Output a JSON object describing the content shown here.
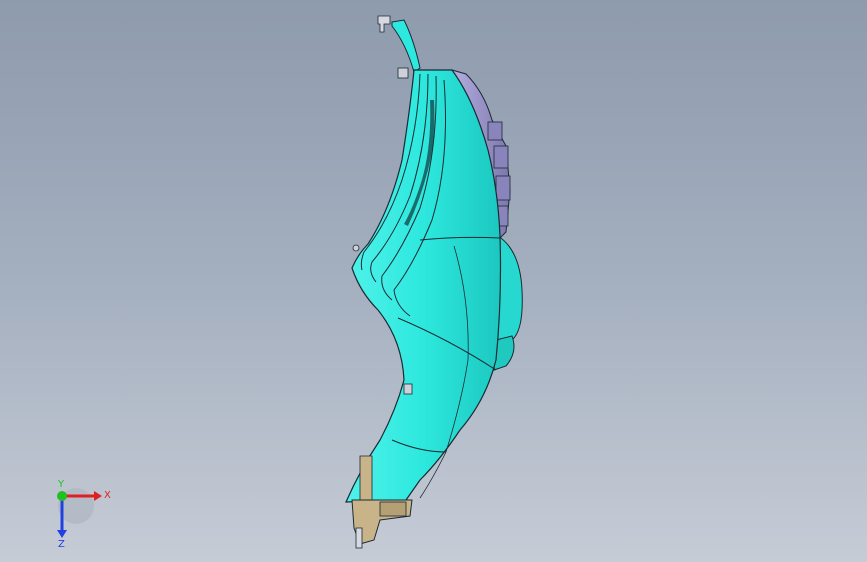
{
  "viewport": {
    "background_top": "#8e9bad",
    "background_bottom": "#c6ccd6"
  },
  "model": {
    "shell_color": "#2de8de",
    "shell_shadow_color": "#1fc9c0",
    "edge_color": "#1a2a33",
    "rear_component_color": "#9a92c8",
    "bracket_color": "#c9b48a"
  },
  "triad": {
    "x_label": "X",
    "y_label": "Y",
    "z_label": "Z",
    "x_color": "#e02020",
    "y_color": "#20c020",
    "z_color": "#2040e0"
  }
}
